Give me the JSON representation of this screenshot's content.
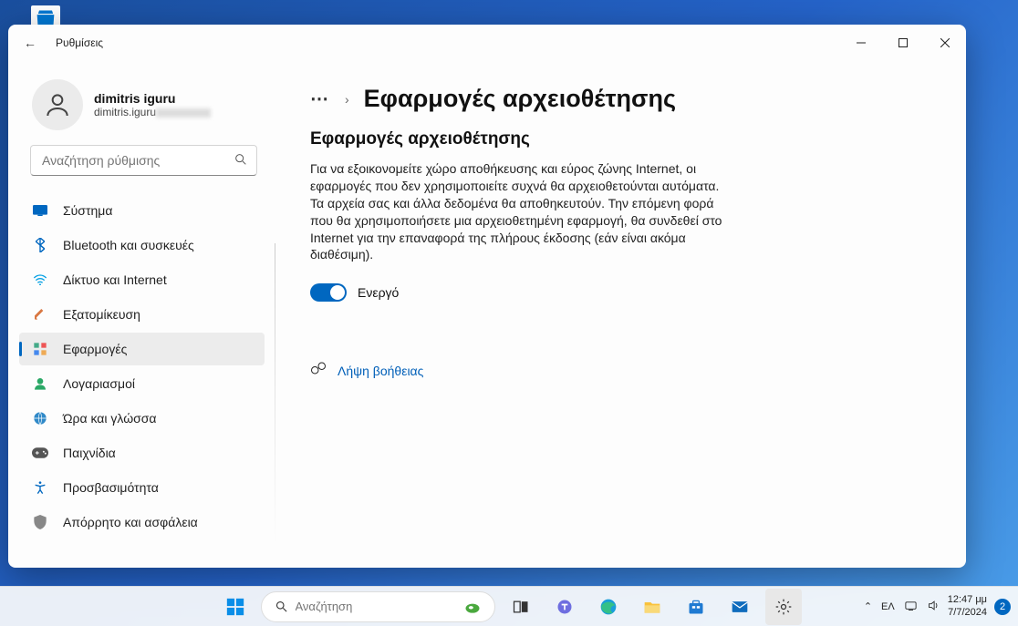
{
  "desktop": {
    "recycle_bin": "Recycle Bin"
  },
  "window": {
    "title": "Ρυθμίσεις",
    "user": {
      "name": "dimitris iguru",
      "email_prefix": "dimitris.iguru"
    },
    "search": {
      "placeholder": "Αναζήτηση ρύθμισης"
    },
    "nav": [
      {
        "id": "system",
        "label": "Σύστημα",
        "icon_color": "#0067c0"
      },
      {
        "id": "bluetooth",
        "label": "Bluetooth και συσκευές",
        "icon_color": "#0067c0"
      },
      {
        "id": "network",
        "label": "Δίκτυο και Internet",
        "icon_color": "#0aa2e4"
      },
      {
        "id": "personalization",
        "label": "Εξατομίκευση",
        "icon_color": "#d97742"
      },
      {
        "id": "apps",
        "label": "Εφαρμογές",
        "icon_color": "#444",
        "active": true
      },
      {
        "id": "accounts",
        "label": "Λογαριασμοί",
        "icon_color": "#2aa866"
      },
      {
        "id": "time",
        "label": "Ώρα και γλώσσα",
        "icon_color": "#3089c8"
      },
      {
        "id": "gaming",
        "label": "Παιχνίδια",
        "icon_color": "#555"
      },
      {
        "id": "accessibility",
        "label": "Προσβασιμότητα",
        "icon_color": "#0067c0"
      },
      {
        "id": "privacy",
        "label": "Απόρρητο και ασφάλεια",
        "icon_color": "#888"
      }
    ],
    "breadcrumb": {
      "ellipsis": "⋯",
      "page_title": "Εφαρμογές αρχειοθέτησης"
    },
    "content": {
      "section_title": "Εφαρμογές αρχειοθέτησης",
      "description": "Για να εξοικονομείτε χώρο αποθήκευσης και εύρος ζώνης Internet, οι εφαρμογές που δεν χρησιμοποιείτε συχνά θα αρχειοθετούνται αυτόματα. Τα αρχεία σας και άλλα δεδομένα θα αποθηκευτούν. Την επόμενη φορά που θα χρησιμοποιήσετε μια αρχειοθετημένη εφαρμογή, θα συνδεθεί στο Internet για την επαναφορά της πλήρους έκδοσης (εάν είναι ακόμα διαθέσιμη).",
      "toggle_on": true,
      "toggle_label": "Ενεργό",
      "help_link": "Λήψη βοήθειας"
    }
  },
  "taskbar": {
    "search_placeholder": "Αναζήτηση",
    "language": "ΕΛ",
    "time": "12:47 μμ",
    "date": "7/7/2024",
    "notifications": "2"
  }
}
